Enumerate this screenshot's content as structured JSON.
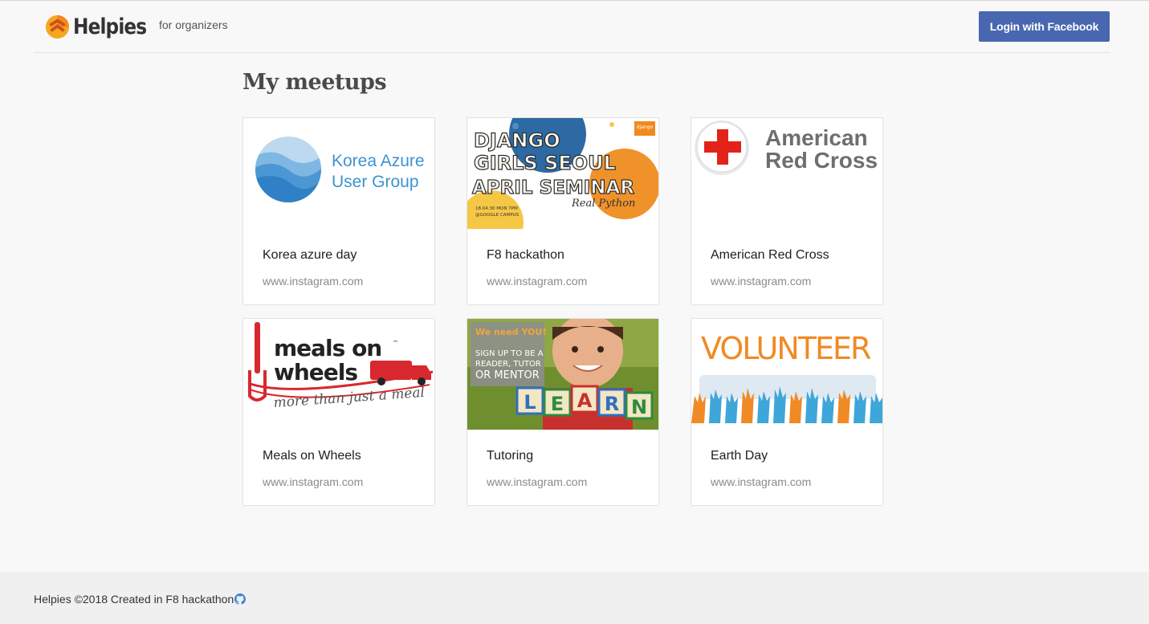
{
  "header": {
    "brand": "Helpies",
    "subtitle": "for organizers",
    "login_label": "Login with Facebook",
    "logo_icon": "helpies-logo-icon",
    "brand_color": "#f5a623",
    "button_color": "#4967b1"
  },
  "main": {
    "title": "My meetups",
    "cards": [
      {
        "title": "Korea azure day",
        "link": "www.instagram.com",
        "image": "korea-azure-user-group-logo",
        "image_text": [
          "Korea Azure",
          "User Group"
        ]
      },
      {
        "title": "F8 hackathon",
        "link": "www.instagram.com",
        "image": "django-girls-seoul-poster",
        "image_text": [
          "DJANGO",
          "GIRLS SEOUL",
          "APRIL SEMINAR",
          "Real Python",
          "18.04.30 MON 7PM",
          "@GOOGLE CAMPUS",
          "django"
        ]
      },
      {
        "title": "American Red Cross",
        "link": "www.instagram.com",
        "image": "american-red-cross-logo",
        "image_text": [
          "American",
          "Red Cross"
        ]
      },
      {
        "title": "Meals on Wheels",
        "link": "www.instagram.com",
        "image": "meals-on-wheels-logo",
        "image_text": [
          "meals on",
          "wheels",
          "more than just a meal",
          "™"
        ]
      },
      {
        "title": "Tutoring",
        "link": "www.instagram.com",
        "image": "tutoring-learn-photo",
        "image_text": [
          "We need YOU!",
          "SIGN UP TO BE A",
          "READER, TUTOR",
          "OR MENTOR",
          "L",
          "E",
          "A",
          "R",
          "N"
        ]
      },
      {
        "title": "Earth Day",
        "link": "www.instagram.com",
        "image": "volunteer-hands-banner",
        "image_text": [
          "VOLUNTEER"
        ]
      }
    ]
  },
  "footer": {
    "text": "Helpies ©2018 Created in F8 hackathon",
    "icon": "github-icon"
  }
}
